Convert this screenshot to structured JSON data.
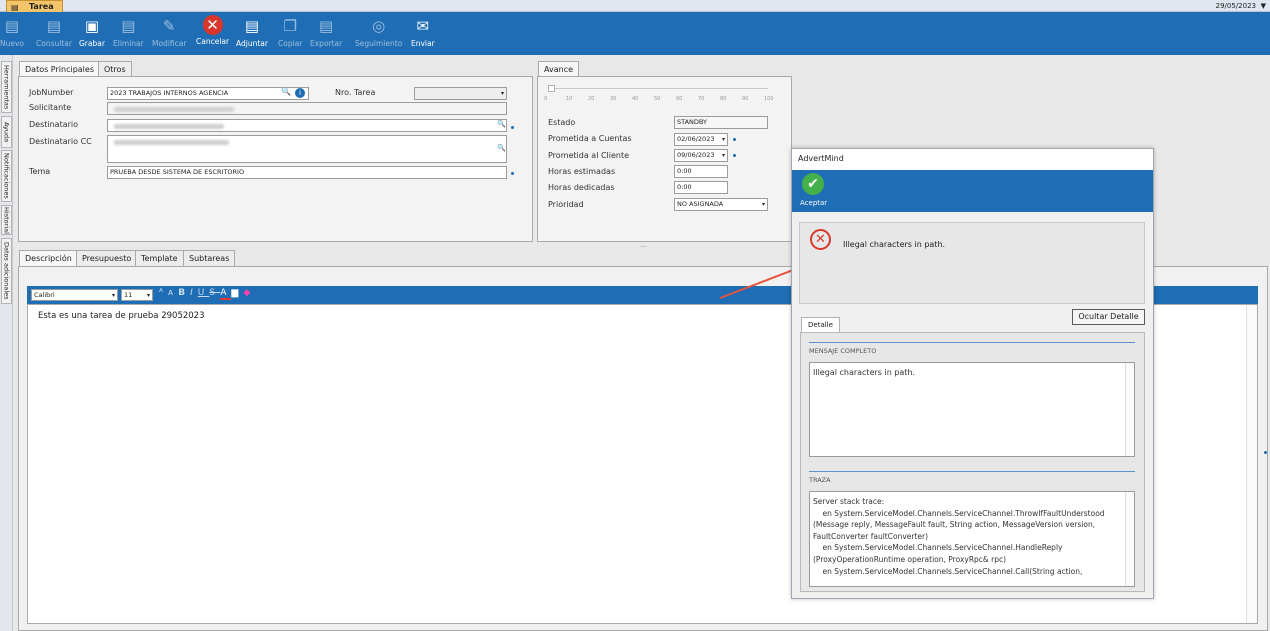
{
  "window": {
    "doc_tab": "Tarea",
    "date": "29/05/2023",
    "date_arrow": "▼"
  },
  "toolbar": [
    {
      "label": "Nuevo",
      "icon": "new-doc-icon",
      "glyph": "▤",
      "enabled": false
    },
    {
      "label": "Consultar",
      "icon": "search-doc-icon",
      "glyph": "▤",
      "enabled": false
    },
    {
      "label": "Grabar",
      "icon": "save-icon",
      "glyph": "▣",
      "enabled": true
    },
    {
      "label": "Eliminar",
      "icon": "delete-doc-icon",
      "glyph": "▤",
      "enabled": false
    },
    {
      "label": "Modificar",
      "icon": "edit-doc-icon",
      "glyph": "✎",
      "enabled": false
    },
    {
      "label": "Cancelar",
      "icon": "cancel-icon",
      "glyph": "✕",
      "enabled": true
    },
    {
      "label": "Adjuntar",
      "icon": "attach-icon",
      "glyph": "▤",
      "enabled": true
    },
    {
      "label": "Copiar",
      "icon": "copy-icon",
      "glyph": "❐",
      "enabled": false
    },
    {
      "label": "Exportar",
      "icon": "export-icon",
      "glyph": "▤",
      "enabled": false
    },
    {
      "label": "Seguimiento",
      "icon": "tracking-icon",
      "glyph": "◎",
      "enabled": false
    },
    {
      "label": "Enviar",
      "icon": "send-mail-icon",
      "glyph": "✉",
      "enabled": true
    }
  ],
  "side_tabs": [
    "Herramientas",
    "Ayuda",
    "Notificaciones",
    "Historial",
    "Datos adicionales"
  ],
  "main_tabs": {
    "principal": "Datos Principales",
    "otros": "Otros"
  },
  "form": {
    "jobnumber_label": "JobNumber",
    "jobnumber_value": "2023 TRABAJOS INTERNOS AGENCIA",
    "nro_tarea_label": "Nro. Tarea",
    "solicitante_label": "Solicitante",
    "destinatario_label": "Destinatario",
    "destinatario_cc_label": "Destinatario CC",
    "tema_label": "Tema",
    "tema_value": "PRUEBA DESDE SISTEMA DE ESCRITORIO"
  },
  "avance": {
    "tab": "Avance",
    "ticks": [
      "0",
      "10",
      "20",
      "30",
      "40",
      "50",
      "60",
      "70",
      "80",
      "90",
      "100"
    ],
    "level_percent": 0,
    "estado_label": "Estado",
    "estado_value": "STANDBY",
    "prometida_cuentas_label": "Prometida a Cuentas",
    "prometida_cuentas_value": "02/06/2023",
    "prometida_cliente_label": "Prometida al Cliente",
    "prometida_cliente_value": "09/06/2023",
    "horas_estimadas_label": "Horas estimadas",
    "horas_estimadas_value": "0:00",
    "horas_dedicadas_label": "Horas dedicadas",
    "horas_dedicadas_value": "0:00",
    "prioridad_label": "Prioridad",
    "prioridad_value": "NO ASIGNADA"
  },
  "splitter": "…",
  "bottom_tabs": [
    "Descripción",
    "Presupuesto",
    "Template",
    "Subtareas"
  ],
  "editor": {
    "font": "Calibri",
    "size": "11",
    "text": "Esta es una tarea de prueba 29052023"
  },
  "dialog": {
    "title": "AdvertMind",
    "accept_label": "Aceptar",
    "error_message": "Illegal characters in path.",
    "hide_detail_button": "Ocultar Detalle",
    "detail_tab": "Detalle",
    "full_message_header": "MENSAJE COMPLETO",
    "full_message": "Illegal characters in path.",
    "trace_header": "TRAZA",
    "trace": "Server stack trace: \n    en System.ServiceModel.Channels.ServiceChannel.ThrowIfFaultUnderstood\n(Message reply, MessageFault fault, String action, MessageVersion version,\nFaultConverter faultConverter)\n    en System.ServiceModel.Channels.ServiceChannel.HandleReply\n(ProxyOperationRuntime operation, ProxyRpc& rpc)\n    en System.ServiceModel.Channels.ServiceChannel.Call(String action,"
  },
  "colors": {
    "ribbon": "#1f6db4",
    "error": "#d9362c",
    "ok": "#43b049",
    "arrow": "#e5533d"
  }
}
